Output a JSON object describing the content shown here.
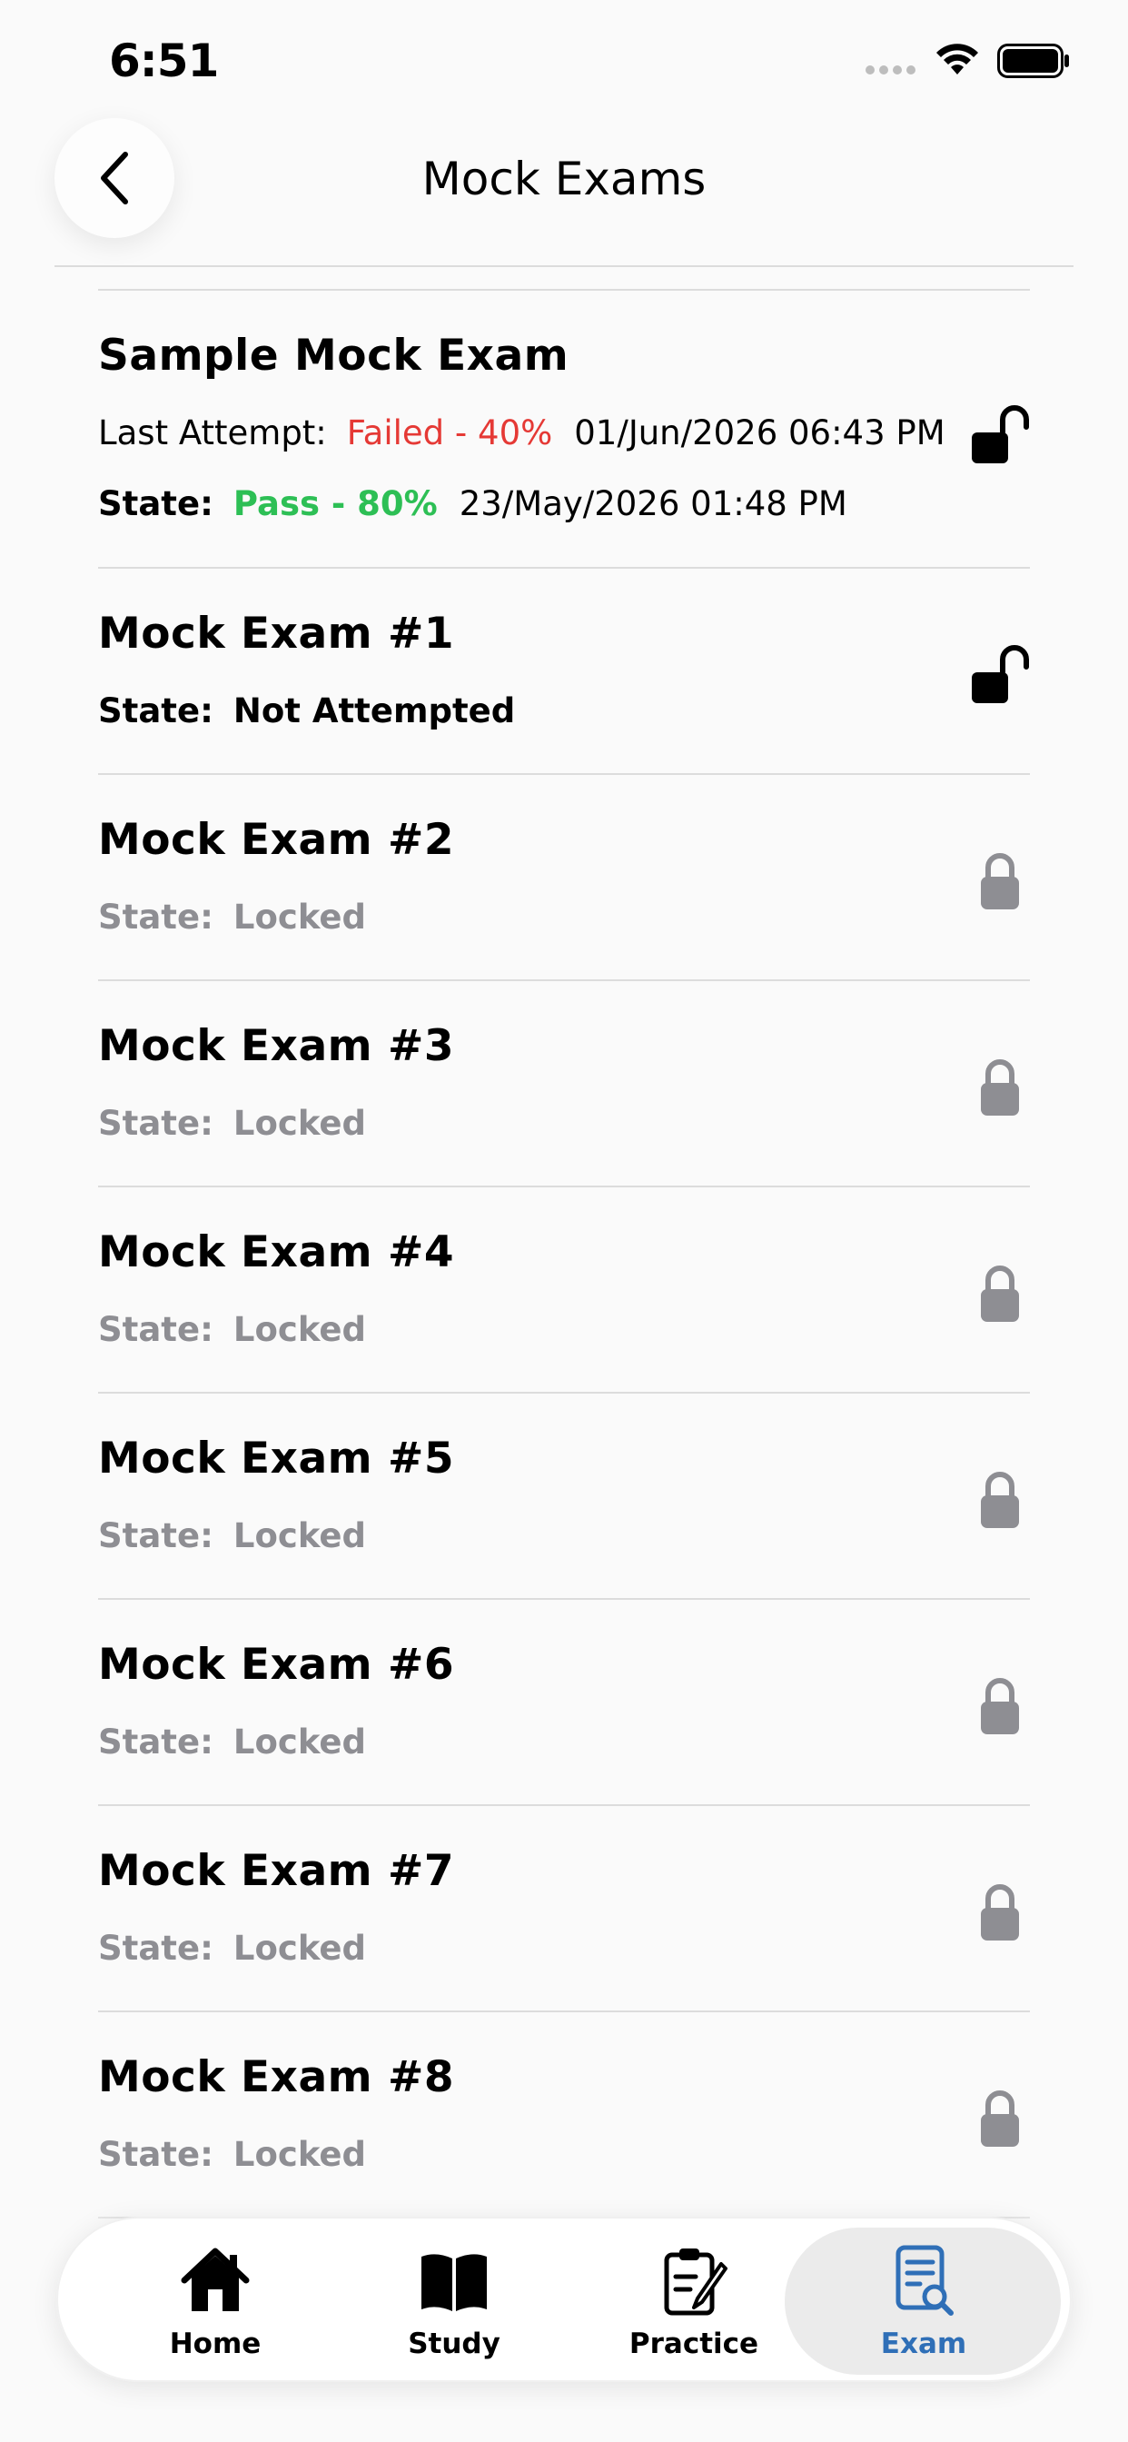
{
  "status_bar": {
    "time": "6:51"
  },
  "header": {
    "title": "Mock Exams"
  },
  "exams": [
    {
      "title": "Sample Mock Exam",
      "last_attempt_label": "Last Attempt:",
      "last_attempt_result": "Failed - 40%",
      "last_attempt_date": "01/Jun/2026 06:43 PM",
      "state_label": "State:",
      "state_result": "Pass - 80%",
      "state_date": "23/May/2026 01:48 PM",
      "lock": "unlocked-icon"
    },
    {
      "title": "Mock Exam #1",
      "state_label": "State:",
      "state_value": "Not Attempted",
      "lock": "unlocked-icon"
    },
    {
      "title": "Mock Exam #2",
      "state_label": "State:",
      "state_value": "Locked",
      "lock": "lock-icon"
    },
    {
      "title": "Mock Exam #3",
      "state_label": "State:",
      "state_value": "Locked",
      "lock": "lock-icon"
    },
    {
      "title": "Mock Exam #4",
      "state_label": "State:",
      "state_value": "Locked",
      "lock": "lock-icon"
    },
    {
      "title": "Mock Exam #5",
      "state_label": "State:",
      "state_value": "Locked",
      "lock": "lock-icon"
    },
    {
      "title": "Mock Exam #6",
      "state_label": "State:",
      "state_value": "Locked",
      "lock": "lock-icon"
    },
    {
      "title": "Mock Exam #7",
      "state_label": "State:",
      "state_value": "Locked",
      "lock": "lock-icon"
    },
    {
      "title": "Mock Exam #8",
      "state_label": "State:",
      "state_value": "Locked",
      "lock": "lock-icon"
    }
  ],
  "bottom_nav": {
    "items": [
      {
        "label": "Home",
        "icon": "home-icon"
      },
      {
        "label": "Study",
        "icon": "book-icon"
      },
      {
        "label": "Practice",
        "icon": "clipboard-edit-icon"
      },
      {
        "label": "Exam",
        "icon": "exam-search-icon"
      }
    ],
    "active": "Exam"
  },
  "colors": {
    "failed": "#e53935",
    "pass": "#2dbf55",
    "locked_gray": "#8e8e93",
    "nav_active": "#2f6fb7"
  }
}
